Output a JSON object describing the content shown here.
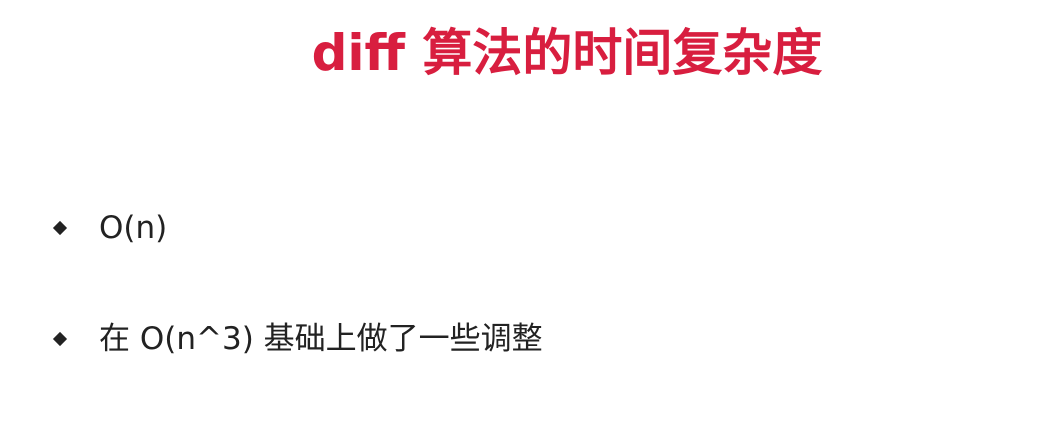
{
  "slide": {
    "title": "diff 算法的时间复杂度",
    "bullets": [
      {
        "text": "O(n)"
      },
      {
        "text": "在 O(n^3) 基础上做了一些调整"
      }
    ]
  },
  "colors": {
    "title": "#d81e3f",
    "body_text": "#222222",
    "background": "#ffffff"
  },
  "icons": {
    "bullet": "diamond-bullet-icon"
  }
}
